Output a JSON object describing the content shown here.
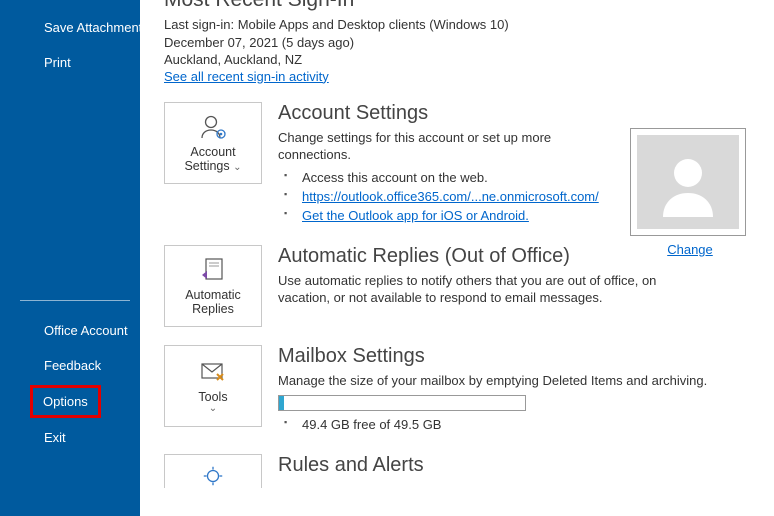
{
  "sidebar": {
    "save_attachments": "Save Attachments",
    "print": "Print",
    "office_account": "Office Account",
    "feedback": "Feedback",
    "options": "Options",
    "exit": "Exit"
  },
  "recent_signin": {
    "heading": "Most Recent Sign-In",
    "line1": "Last sign-in: Mobile Apps and Desktop clients (Windows 10)",
    "line2": "December 07, 2021 (5 days ago)",
    "line3": "Auckland, Auckland, NZ",
    "link": "See all recent sign-in activity"
  },
  "account_settings": {
    "tile_label_1": "Account",
    "tile_label_2": "Settings",
    "caret": "⌄",
    "heading": "Account Settings",
    "desc": "Change settings for this account or set up more connections.",
    "bullet1": "Access this account on the web.",
    "bullet2": "https://outlook.office365.com/...ne.onmicrosoft.com/",
    "bullet3": "Get the Outlook app for iOS or Android."
  },
  "avatar": {
    "change": "Change"
  },
  "auto_replies": {
    "tile_label_1": "Automatic",
    "tile_label_2": "Replies",
    "heading": "Automatic Replies (Out of Office)",
    "desc": "Use automatic replies to notify others that you are out of office, on vacation, or not available to respond to email messages."
  },
  "mailbox": {
    "tile_label": "Tools",
    "caret": "⌄",
    "heading": "Mailbox Settings",
    "desc": "Manage the size of your mailbox by emptying Deleted Items and archiving.",
    "free_text": "49.4 GB free of 49.5 GB"
  },
  "rules": {
    "heading": "Rules and Alerts"
  }
}
